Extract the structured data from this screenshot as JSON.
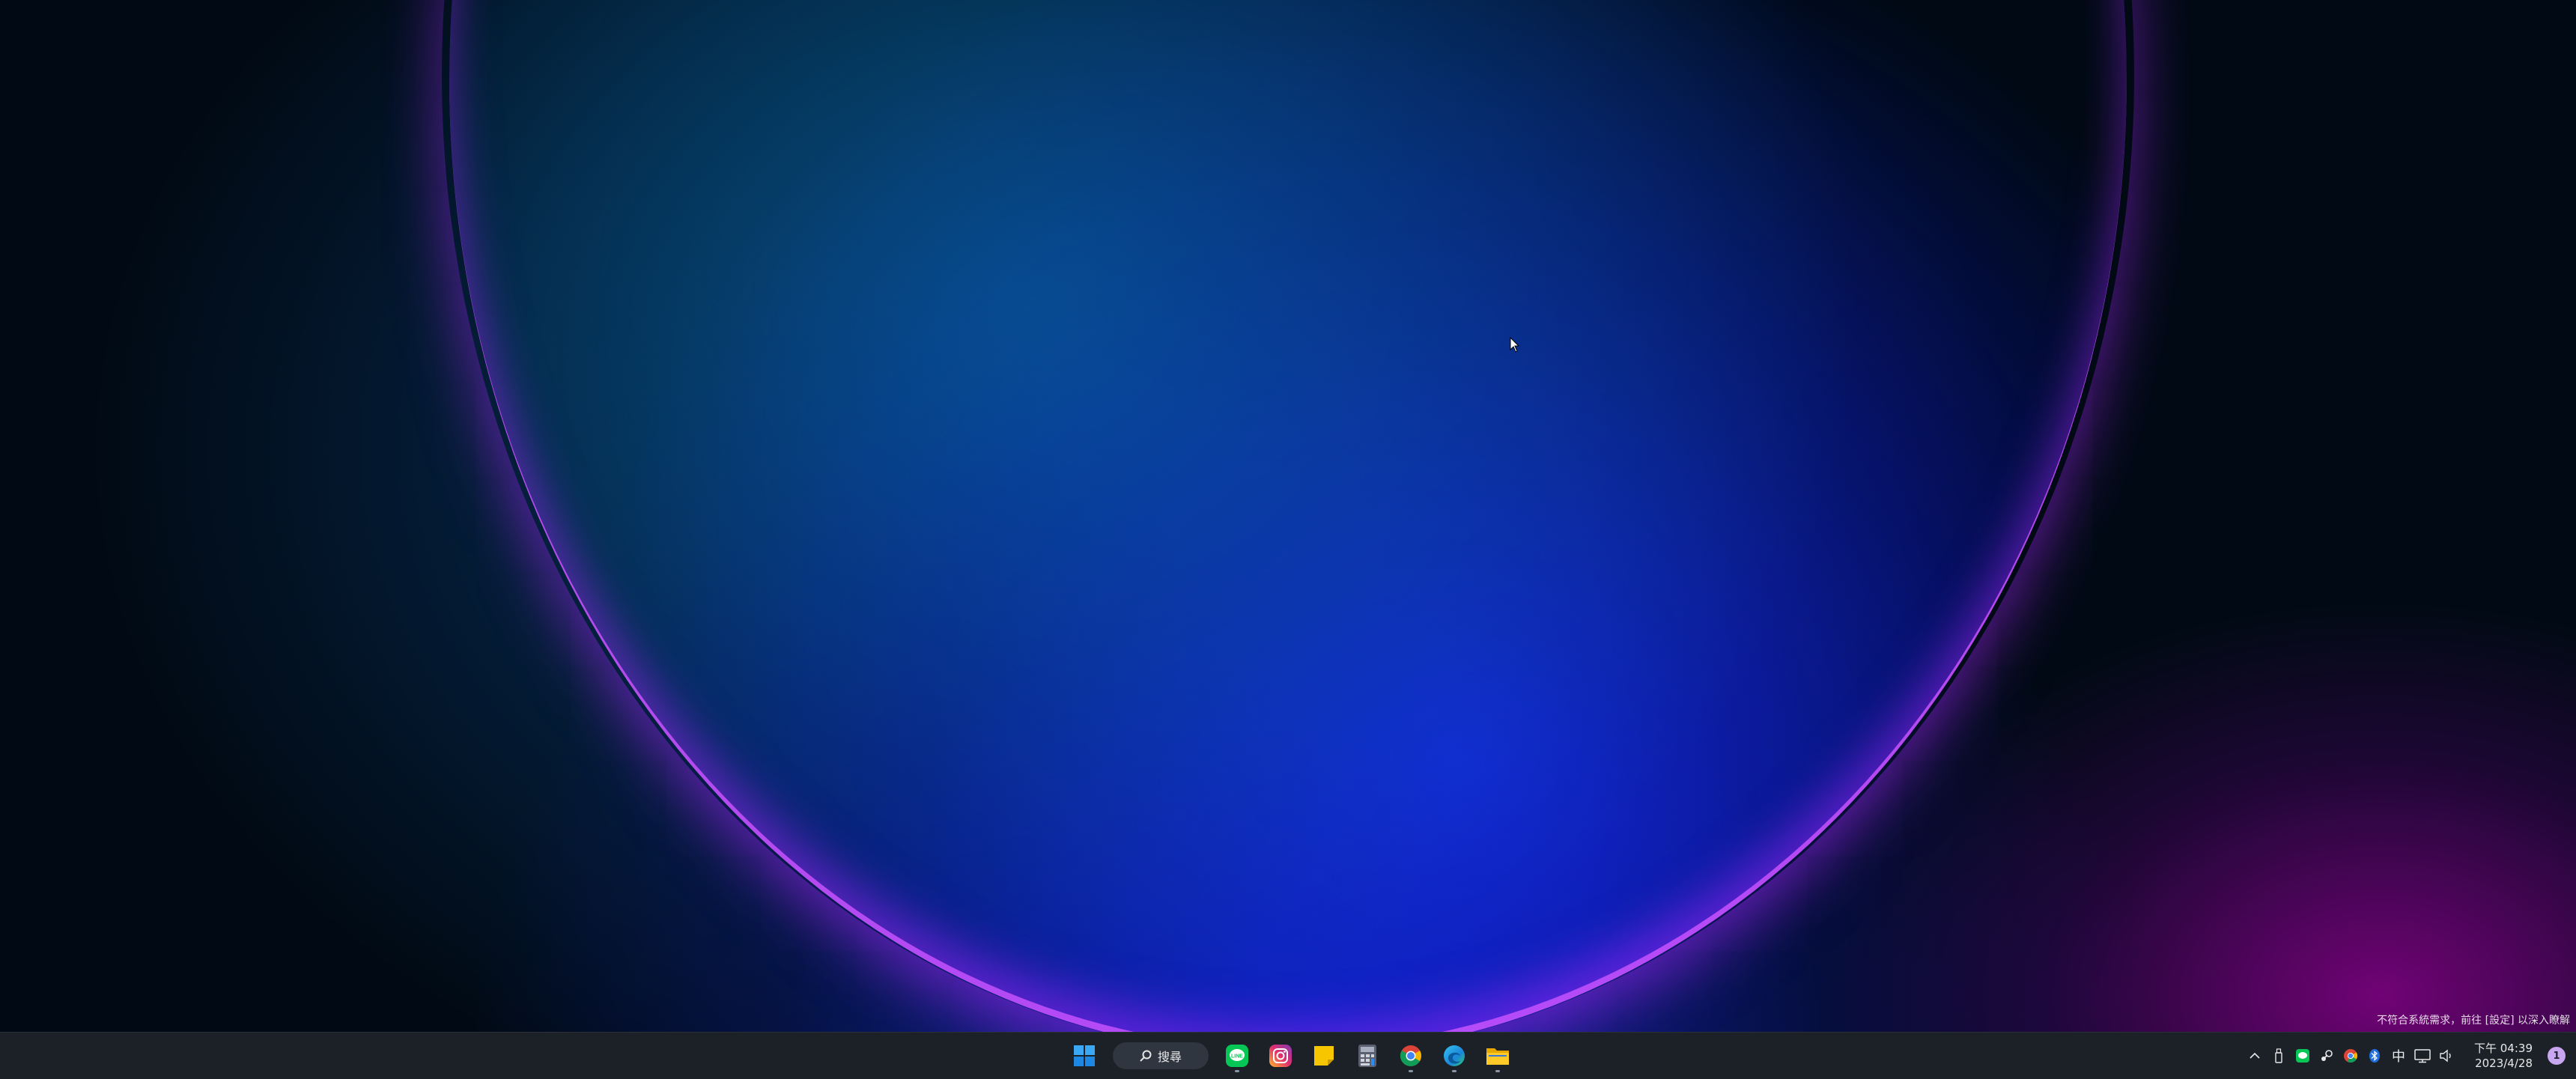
{
  "desktop": {
    "activation_notice": "不符合系統需求，前往 [設定] 以深入瞭解"
  },
  "taskbar": {
    "search_label": "搜尋",
    "apps": [
      {
        "name": "start",
        "icon": "windows-logo-icon",
        "running": false
      },
      {
        "name": "line",
        "icon": "line-icon",
        "running": true
      },
      {
        "name": "instagram",
        "icon": "instagram-icon",
        "running": false
      },
      {
        "name": "sticky-notes",
        "icon": "sticky-notes-icon",
        "running": false
      },
      {
        "name": "calculator",
        "icon": "calculator-icon",
        "running": false
      },
      {
        "name": "chrome",
        "icon": "chrome-icon",
        "running": true
      },
      {
        "name": "edge",
        "icon": "edge-icon",
        "running": true
      },
      {
        "name": "file-explorer",
        "icon": "folder-icon",
        "running": true
      }
    ],
    "tray": {
      "ime_label": "中",
      "time": "下午 04:39",
      "date": "2023/4/28",
      "notification_count": "1"
    }
  },
  "colors": {
    "taskbar_bg": "#1c2128",
    "accent_purple": "#c060ff",
    "accent_blue": "#1428e6"
  }
}
